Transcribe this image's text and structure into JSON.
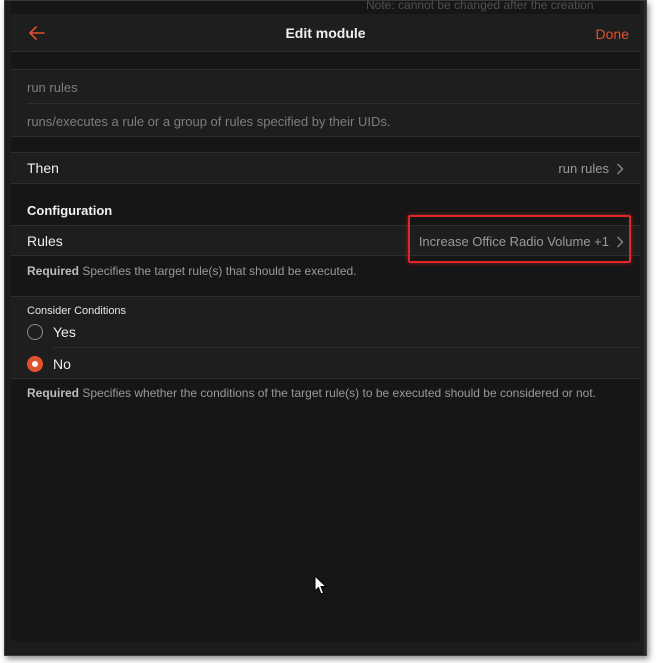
{
  "ghost_note": "Note: cannot be changed after the creation",
  "navbar": {
    "title": "Edit module",
    "done_label": "Done",
    "back_icon": "arrow-left-icon"
  },
  "module_info": {
    "name": "run rules",
    "description": "runs/executes a rule or a group of rules specified by their UIDs."
  },
  "then_row": {
    "label": "Then",
    "value": "run rules"
  },
  "configuration": {
    "title": "Configuration",
    "rules": {
      "label": "Rules",
      "value": "Increase Office Radio Volume +1",
      "hint_required": "Required",
      "hint_text": "Specifies the target rule(s) that should be executed."
    },
    "consider_conditions": {
      "label": "Consider Conditions",
      "options": [
        {
          "label": "Yes",
          "checked": false
        },
        {
          "label": "No",
          "checked": true
        }
      ],
      "hint_required": "Required",
      "hint_text": "Specifies whether the conditions of the target rule(s) to be executed should be considered or not."
    }
  },
  "colors": {
    "accent": "#e0522b",
    "highlight": "#e0262a",
    "background": "#161616"
  }
}
